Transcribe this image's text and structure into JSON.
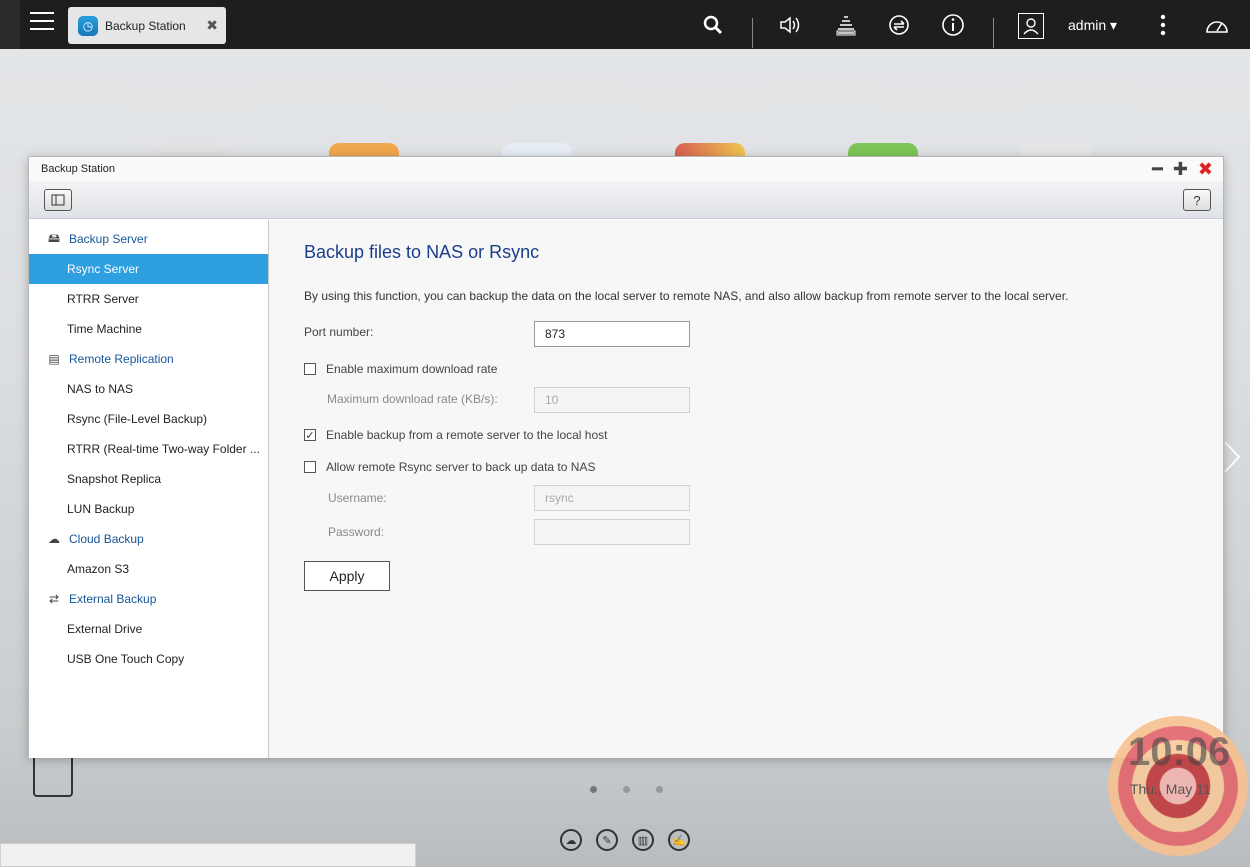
{
  "topbar": {
    "app_tab_label": "Backup Station",
    "user": "admin"
  },
  "window": {
    "title": "Backup Station",
    "help_label": "?"
  },
  "sidebar": {
    "groups": [
      {
        "label": "Backup Server",
        "items": [
          "Rsync Server",
          "RTRR Server",
          "Time Machine"
        ]
      },
      {
        "label": "Remote Replication",
        "items": [
          "NAS to NAS",
          "Rsync (File-Level Backup)",
          "RTRR (Real-time Two-way Folder ...",
          "Snapshot Replica",
          "LUN Backup"
        ]
      },
      {
        "label": "Cloud Backup",
        "items": [
          "Amazon S3"
        ]
      },
      {
        "label": "External Backup",
        "items": [
          "External Drive",
          "USB One Touch Copy"
        ]
      }
    ],
    "active_item": "Rsync Server"
  },
  "main": {
    "title": "Backup files to NAS or Rsync",
    "description": "By using this function, you can backup the data on the local server to remote NAS, and also allow backup from remote server to the local server.",
    "port_label": "Port number:",
    "port_value": "873",
    "enable_max_rate_label": "Enable maximum download rate",
    "enable_max_rate_checked": false,
    "max_rate_label": "Maximum download rate (KB/s):",
    "max_rate_value": "10",
    "enable_remote_backup_label": "Enable backup from a remote server to the local host",
    "enable_remote_backup_checked": true,
    "allow_remote_rsync_label": "Allow remote Rsync server to back up data to NAS",
    "allow_remote_rsync_checked": false,
    "username_label": "Username:",
    "username_value": "rsync",
    "password_label": "Password:",
    "password_value": "",
    "apply_label": "Apply"
  },
  "desktop": {
    "clock_time": "10:06",
    "clock_date": "Thu., May 11",
    "page_dots": 3,
    "active_page": 1
  },
  "colors": {
    "accent": "#2e9fe0",
    "title_blue": "#1b3e8a",
    "group_blue": "#16569a",
    "topbar": "#1e1e1e",
    "close_red": "#dd2222"
  }
}
